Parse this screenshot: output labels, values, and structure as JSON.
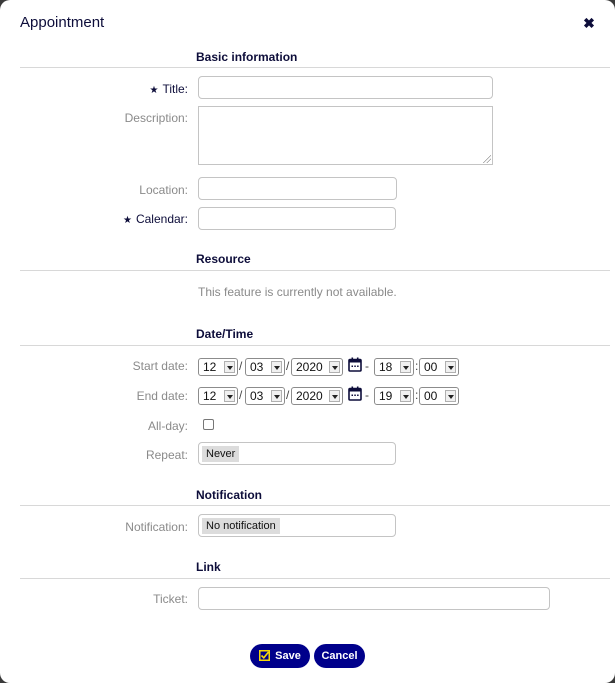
{
  "dialog": {
    "title": "Appointment",
    "close_label": "✖"
  },
  "sections": {
    "basic": "Basic information",
    "resource": "Resource",
    "datetime": "Date/Time",
    "notification": "Notification",
    "link": "Link"
  },
  "basic": {
    "title_label": "Title:",
    "title_value": "",
    "title_required": "★",
    "description_label": "Description:",
    "description_value": "",
    "location_label": "Location:",
    "location_value": "",
    "calendar_label": "Calendar:",
    "calendar_value": "",
    "calendar_required": "★"
  },
  "resource": {
    "note": "This feature is currently not available."
  },
  "datetime": {
    "start_label": "Start date:",
    "start": {
      "month": "12",
      "day": "03",
      "year": "2020",
      "hour": "18",
      "minute": "00"
    },
    "end_label": "End date:",
    "end": {
      "month": "12",
      "day": "03",
      "year": "2020",
      "hour": "19",
      "minute": "00"
    },
    "date_sep": "/",
    "range_sep": "-",
    "time_sep": ":",
    "allday_label": "All-day:",
    "allday_checked": false,
    "repeat_label": "Repeat:",
    "repeat_value": "Never"
  },
  "notification": {
    "label": "Notification:",
    "value": "No notification"
  },
  "link": {
    "ticket_label": "Ticket:",
    "ticket_value": ""
  },
  "actions": {
    "save_label": "Save",
    "cancel_label": "Cancel"
  },
  "colors": {
    "accent": "#00008b",
    "heading": "#0d0d3a",
    "label": "#8a8a8a",
    "check_icon": "#f5d90a"
  }
}
